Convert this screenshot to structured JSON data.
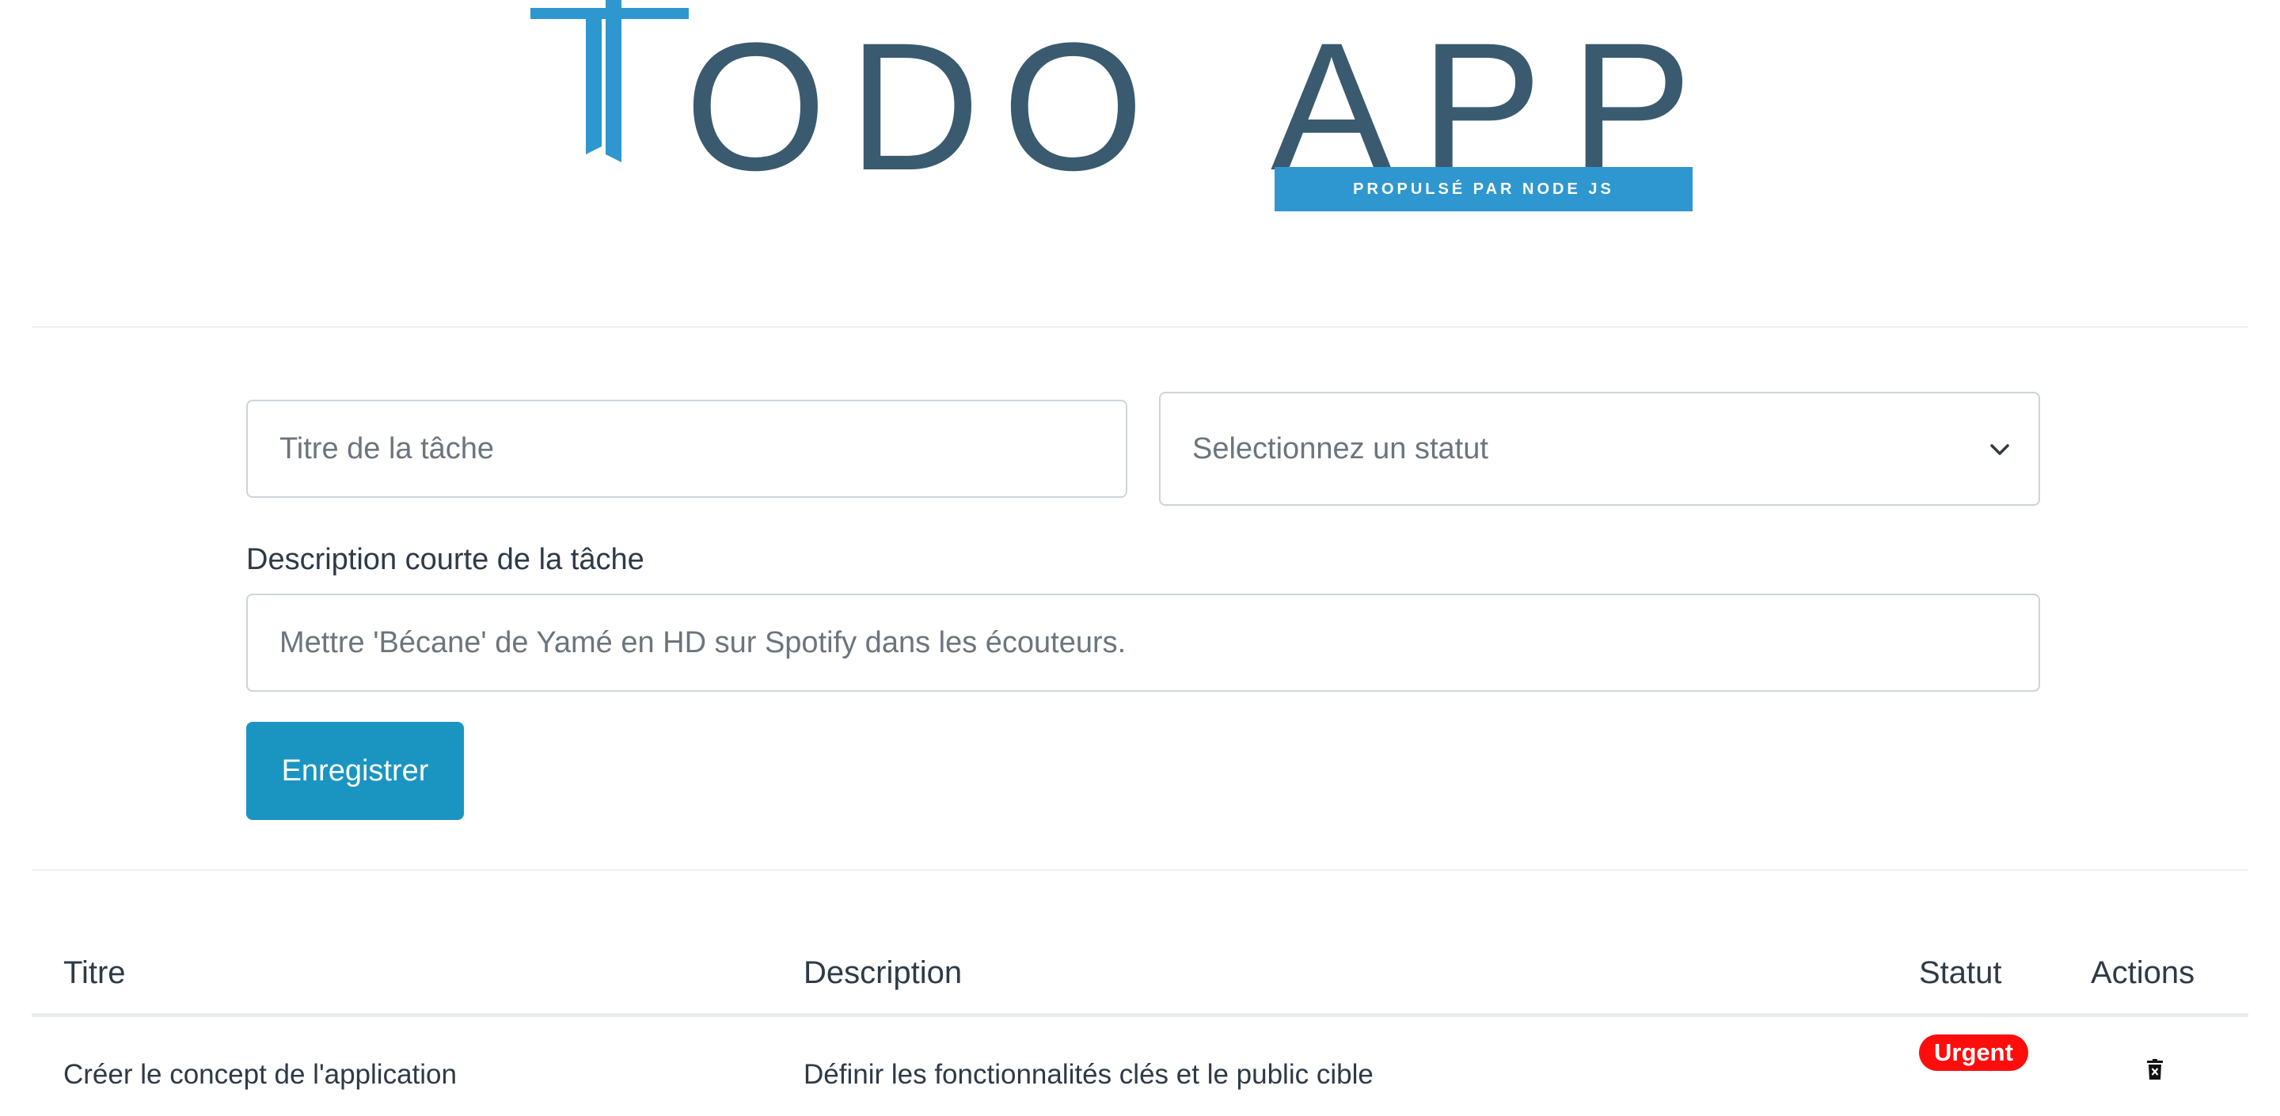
{
  "logo": {
    "word_odo": "ODO",
    "word_app": "APP",
    "tagline": "PROPULSÉ PAR NODE JS",
    "colors": {
      "primary": "#3a5a70",
      "accent": "#2e97d0"
    }
  },
  "form": {
    "title_placeholder": "Titre de la tâche",
    "status_placeholder": "Selectionnez un statut",
    "description_label": "Description courte de la tâche",
    "description_placeholder": "Mettre 'Bécane' de Yamé en HD sur Spotify dans les écouteurs.",
    "submit_label": "Enregistrer",
    "submit_color": "#1a95c2"
  },
  "table": {
    "headers": {
      "title": "Titre",
      "description": "Description",
      "status": "Statut",
      "actions": "Actions"
    },
    "rows": [
      {
        "title": "Créer le concept de l'application",
        "description": "Définir les fonctionnalités clés et le public cible",
        "status": "Urgent",
        "status_color": "#ff0d0d",
        "action_icon": "trash-icon"
      }
    ]
  }
}
